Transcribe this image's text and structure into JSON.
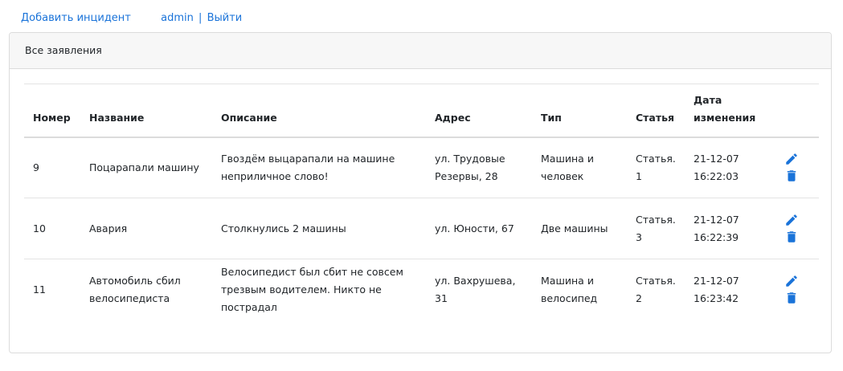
{
  "nav": {
    "add_incident": "Добавить инцидент",
    "user": "admin",
    "separator": "|",
    "logout": "Выйти"
  },
  "card": {
    "title": "Все заявления"
  },
  "table": {
    "headers": {
      "number": "Номер",
      "name": "Название",
      "description": "Описание",
      "address": "Адрес",
      "type": "Тип",
      "article": "Статья",
      "date_line1": "Дата",
      "date_line2": "изменения"
    },
    "rows": [
      {
        "number": "9",
        "name": "Поцарапали машину",
        "description": "Гвоздём выцарапали на машине неприличное слово!",
        "address": "ул. Трудовые Резервы, 28",
        "type": "Машина и человек",
        "article": "Статья. 1",
        "date_line1": "21-12-07",
        "date_line2": "16:22:03"
      },
      {
        "number": "10",
        "name": "Авария",
        "description": "Столкнулись 2 машины",
        "address": "ул. Юности, 67",
        "type": "Две машины",
        "article": "Статья. 3",
        "date_line1": "21-12-07",
        "date_line2": "16:22:39"
      },
      {
        "number": "11",
        "name": "Автомобиль сбил велосипедиста",
        "description": "Велосипедист был сбит не совсем трезвым водителем. Никто не пострадал",
        "address": "ул. Вахрушева, 31",
        "type": "Машина и велосипед",
        "article": "Статья. 2",
        "date_line1": "21-12-07",
        "date_line2": "16:23:42"
      }
    ]
  },
  "icons": {
    "edit": "pencil-icon",
    "delete": "trash-icon"
  },
  "colors": {
    "accent": "#1a73d9"
  }
}
